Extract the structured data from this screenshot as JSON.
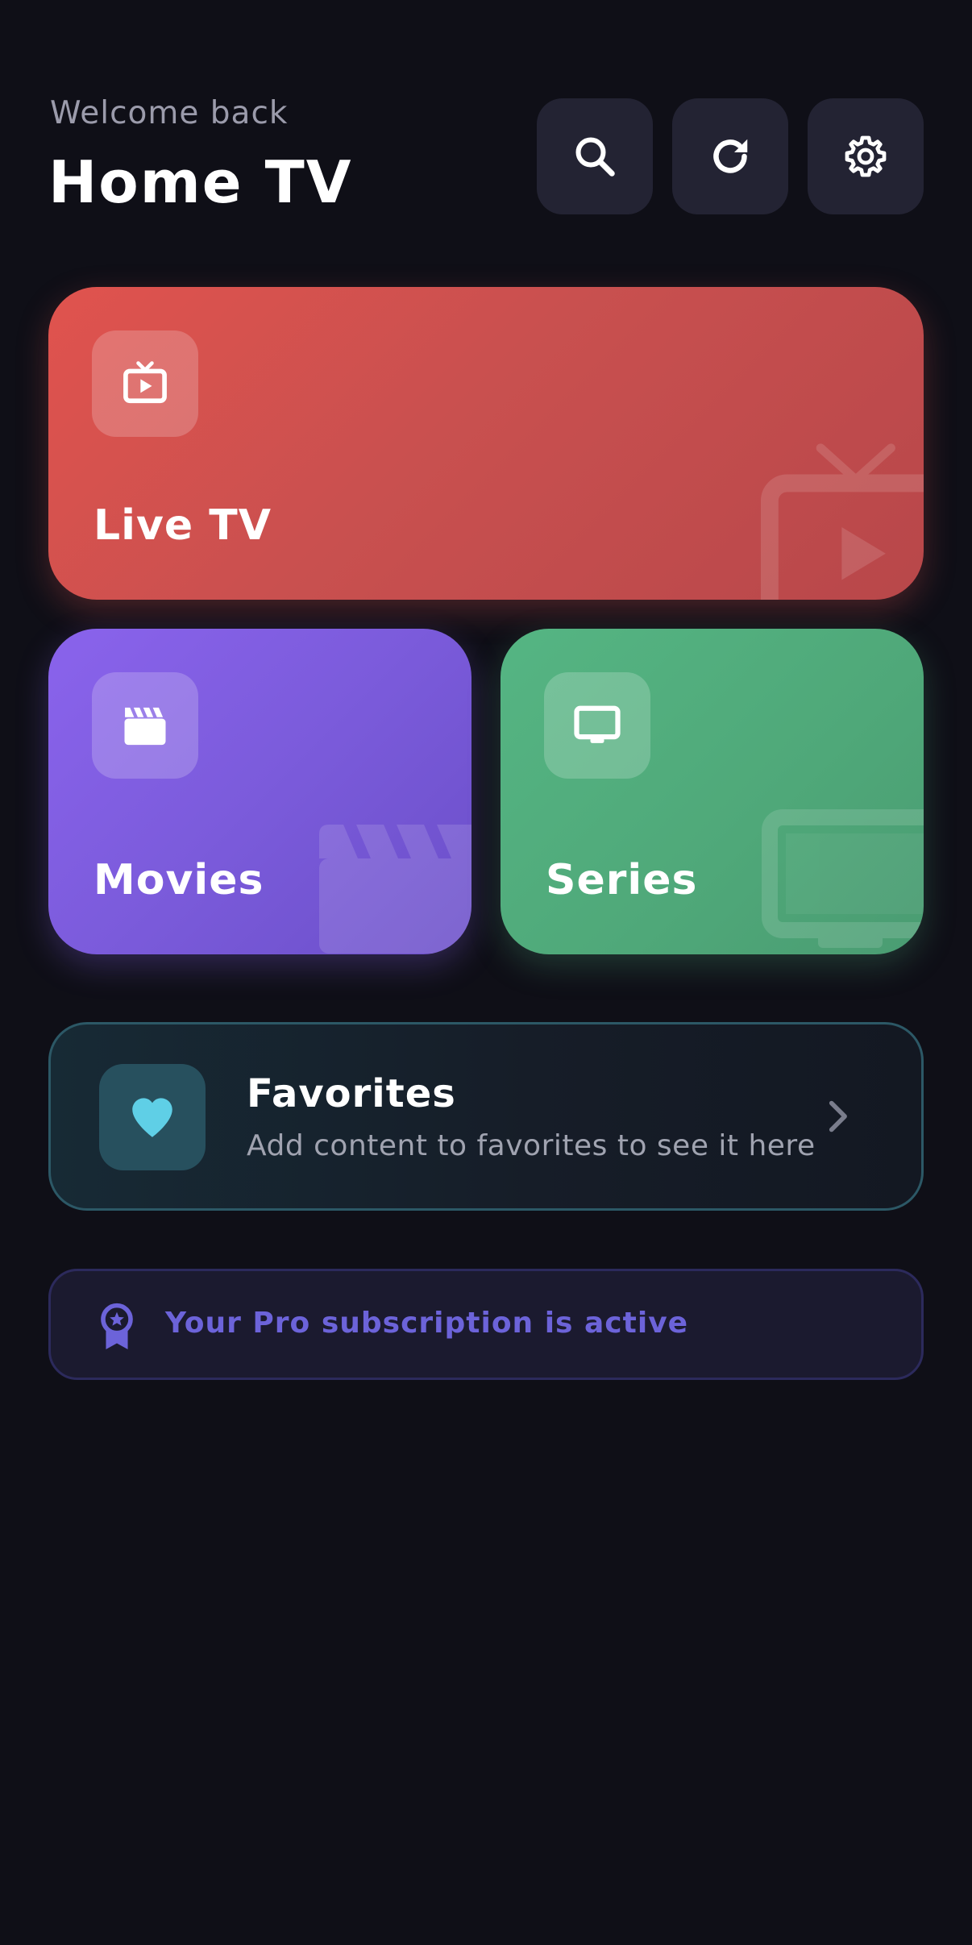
{
  "header": {
    "welcome": "Welcome back",
    "title": "Home TV",
    "buttons": [
      {
        "icon": "search-icon"
      },
      {
        "icon": "refresh-icon"
      },
      {
        "icon": "gear-icon"
      }
    ]
  },
  "tiles": {
    "live_tv": {
      "label": "Live TV",
      "icon": "tv-play-icon",
      "color": "#e0534e"
    },
    "movies": {
      "label": "Movies",
      "icon": "clapperboard-icon",
      "color": "#8a63ec"
    },
    "series": {
      "label": "Series",
      "icon": "monitor-icon",
      "color": "#55b583"
    }
  },
  "favorites": {
    "title": "Favorites",
    "subtitle": "Add content to favorites to see it here",
    "icon": "heart-icon",
    "accent": "#5fcfe6"
  },
  "subscription": {
    "text": "Your Pro subscription is active",
    "icon": "award-icon",
    "accent": "#6c63d9"
  }
}
